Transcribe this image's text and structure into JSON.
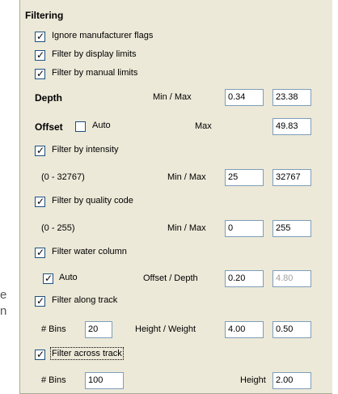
{
  "side_clip": {
    "line1": "e",
    "line2": "n"
  },
  "group_title": "Filtering",
  "ignore_flags": {
    "label": "Ignore manufacturer flags",
    "checked": true
  },
  "display_limits": {
    "label": "Filter by display limits",
    "checked": true
  },
  "manual_limits": {
    "label": "Filter by manual limits",
    "checked": true
  },
  "depth": {
    "label": "Depth",
    "minmax_label": "Min / Max",
    "min": "0.34",
    "max": "23.38"
  },
  "offset": {
    "label": "Offset",
    "auto_label": "Auto",
    "auto_checked": false,
    "max_label": "Max",
    "max": "49.83"
  },
  "intensity": {
    "label": "Filter by intensity",
    "checked": true,
    "range": "(0 - 32767)",
    "minmax_label": "Min / Max",
    "min": "25",
    "max": "32767"
  },
  "quality": {
    "label": "Filter by quality code",
    "checked": true,
    "range": "(0 - 255)",
    "minmax_label": "Min / Max",
    "min": "0",
    "max": "255"
  },
  "water_column": {
    "label": "Filter water column",
    "checked": true,
    "auto_label": "Auto",
    "auto_checked": true,
    "offset_depth_label": "Offset / Depth",
    "offset": "0.20",
    "depth": "4.80"
  },
  "along_track": {
    "label": "Filter along track",
    "checked": true,
    "bins_label": "# Bins",
    "bins": "20",
    "hw_label": "Height / Weight",
    "height": "4.00",
    "weight": "0.50"
  },
  "across_track": {
    "label": "Filter across track",
    "checked": true,
    "bins_label": "# Bins",
    "bins": "100",
    "height_label": "Height",
    "height": "2.00"
  }
}
